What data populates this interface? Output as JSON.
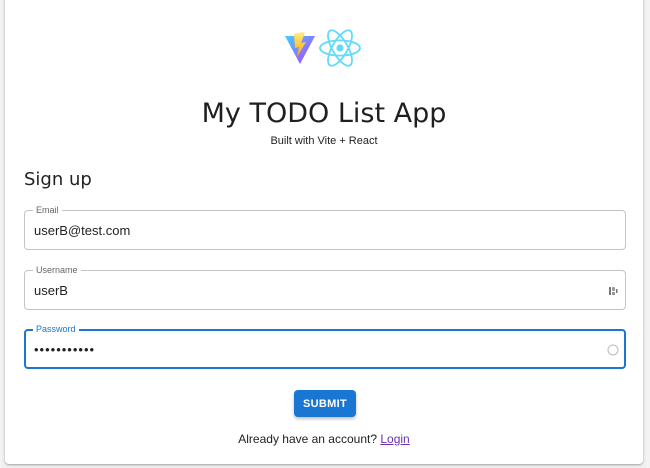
{
  "header": {
    "logos": [
      "vite-logo-icon",
      "react-logo-icon"
    ],
    "title": "My TODO List App",
    "subtitle": "Built with Vite + React"
  },
  "form": {
    "title": "Sign up",
    "email": {
      "label": "Email",
      "value": "userB@test.com"
    },
    "username": {
      "label": "Username",
      "value": "userB",
      "icon": "password-manager-icon"
    },
    "password": {
      "label": "Password",
      "value": "•••••••••••",
      "icon": "loading-circle-icon",
      "focused": true
    },
    "submit_label": "SUBMIT"
  },
  "footer": {
    "text": "Already have an account?",
    "link_label": "Login"
  },
  "colors": {
    "accent": "#1976d2",
    "link": "#6b2fb3",
    "border": "#c4c4c4"
  }
}
